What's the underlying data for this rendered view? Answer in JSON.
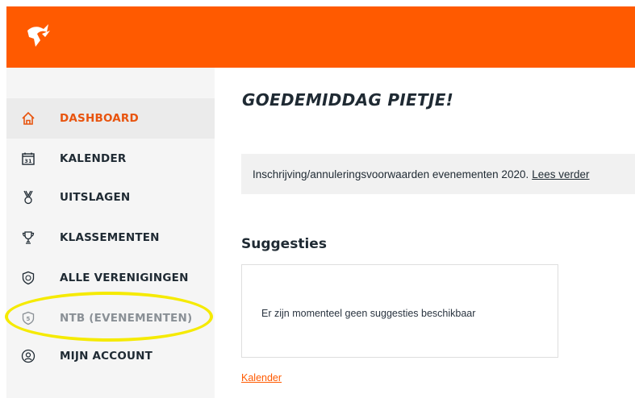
{
  "colors": {
    "brand": "#ff5a00",
    "active_text": "#e8540e",
    "annotation": "#f5ea00"
  },
  "header": {
    "logo": "brand-logo-icon"
  },
  "sidebar": {
    "items": [
      {
        "label": "DASHBOARD",
        "icon": "home-icon",
        "active": true
      },
      {
        "label": "KALENDER",
        "icon": "calendar-icon",
        "active": false
      },
      {
        "label": "UITSLAGEN",
        "icon": "medal-icon",
        "active": false
      },
      {
        "label": "KLASSEMENTEN",
        "icon": "trophy-icon",
        "active": false
      },
      {
        "label": "ALLE VERENIGINGEN",
        "icon": "club-shield-icon",
        "active": false
      },
      {
        "label": "NTB (EVENEMENTEN)",
        "icon": "ntb-shield-icon",
        "active": false
      },
      {
        "label": "MIJN ACCOUNT",
        "icon": "account-icon",
        "active": false
      }
    ]
  },
  "main": {
    "greeting": "GOEDEMIDDAG PIETJE!",
    "notice": {
      "text": "Inschrijving/annuleringsvoorwaarden evenementen 2020.",
      "link": "Lees verder"
    },
    "suggestions": {
      "title": "Suggesties",
      "empty_text": "Er zijn momenteel geen suggesties beschikbaar"
    },
    "calendar_link": "Kalender"
  }
}
